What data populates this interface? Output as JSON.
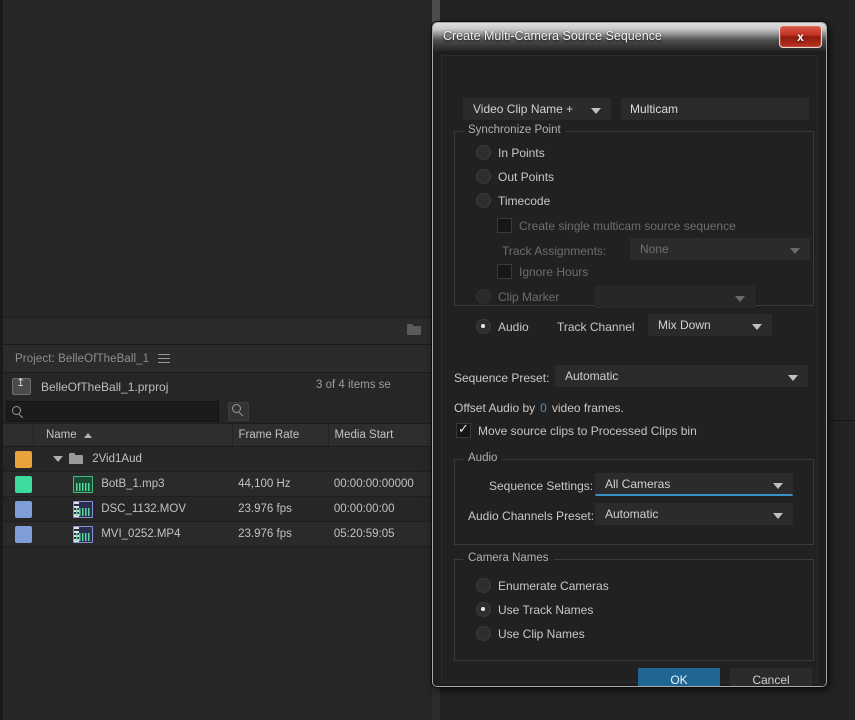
{
  "background": {
    "source_panel": {
      "folder_icon": "folder-icon"
    },
    "project_panel": {
      "tab_title": "Project: BelleOfTheBall_1",
      "menu_icon": "hamburger-menu-icon",
      "project_file": "BelleOfTheBall_1.prproj",
      "parent_bin_icon": "go-to-parent-bin-icon",
      "item_count": "3 of 4 items se",
      "search": {
        "placeholder": "",
        "value": "",
        "icon": "search-icon"
      },
      "find_icon": "find-icon",
      "columns": [
        "",
        "Name",
        "Frame Rate",
        "Media Start"
      ],
      "sort_indicator": "ascending-sort-caret",
      "rows": [
        {
          "swatch": "#e8a33d",
          "kind": "bin",
          "expanded": true,
          "name": "2Vid1Aud",
          "frame_rate": "",
          "media_start": ""
        },
        {
          "swatch": "#3ddc9c",
          "kind": "audio",
          "name": "BotB_1.mp3",
          "frame_rate": "44,100 Hz",
          "media_start": "00:00:00:00000"
        },
        {
          "swatch": "#7f9ed6",
          "kind": "video",
          "name": "DSC_1132.MOV",
          "frame_rate": "23.976 fps",
          "media_start": "00:00:00:00"
        },
        {
          "swatch": "#7f9ed6",
          "kind": "video",
          "name": "MVI_0252.MP4",
          "frame_rate": "23.976 fps",
          "media_start": "05:20:59:05"
        }
      ]
    }
  },
  "dialog": {
    "title": "Create Multi-Camera Source Sequence",
    "close_label": "x",
    "naming": {
      "preset_dropdown": "Video Clip Name +",
      "name_value": "Multicam"
    },
    "synchronize_point": {
      "group_title": "Synchronize Point",
      "options": [
        {
          "label": "In Points",
          "selected": false,
          "disabled": false
        },
        {
          "label": "Out Points",
          "selected": false,
          "disabled": false
        },
        {
          "label": "Timecode",
          "selected": false,
          "disabled": false
        }
      ],
      "create_single_multicam": {
        "label": "Create single multicam source sequence",
        "checked": false,
        "disabled": true
      },
      "track_assignments": {
        "label": "Track Assignments:",
        "value": "None",
        "disabled": true
      },
      "ignore_hours": {
        "label": "Ignore Hours",
        "checked": false,
        "disabled": true
      },
      "clip_marker": {
        "label": "Clip Marker",
        "selected": false,
        "disabled": true,
        "value": ""
      },
      "audio": {
        "label": "Audio",
        "selected": true,
        "track_channel_label": "Track Channel",
        "track_channel_value": "Mix Down"
      }
    },
    "sequence_preset": {
      "label": "Sequence Preset:",
      "value": "Automatic"
    },
    "offset_audio": {
      "prefix": "Offset Audio by",
      "value": "0",
      "suffix": "video frames."
    },
    "move_source_clips": {
      "label": "Move source clips to Processed Clips bin",
      "checked": true
    },
    "audio_group": {
      "group_title": "Audio",
      "sequence_settings": {
        "label": "Sequence Settings:",
        "value": "All Cameras",
        "focused": true
      },
      "audio_channels_preset": {
        "label": "Audio Channels Preset:",
        "value": "Automatic"
      }
    },
    "camera_names": {
      "group_title": "Camera Names",
      "options": [
        {
          "label": "Enumerate Cameras",
          "selected": false
        },
        {
          "label": "Use Track Names",
          "selected": true
        },
        {
          "label": "Use Clip Names",
          "selected": false
        }
      ]
    },
    "buttons": {
      "ok": "OK",
      "cancel": "Cancel"
    },
    "colors": {
      "accent": "#1f6694",
      "focus": "#3b8fc7",
      "scrub": "#4b8fc4",
      "close": "#c23222"
    }
  }
}
